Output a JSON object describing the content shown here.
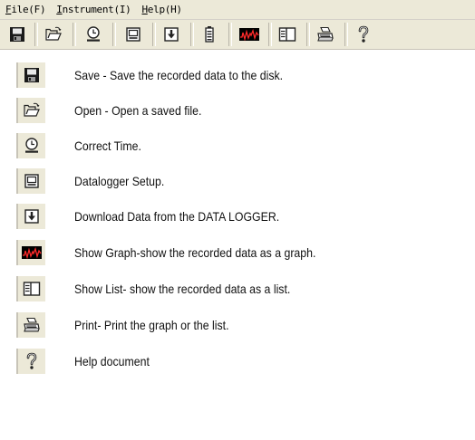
{
  "menubar": {
    "items": [
      {
        "key": "F",
        "rest": "ile(F)",
        "name": "menu-file"
      },
      {
        "key": "I",
        "rest": "nstrument(I)",
        "name": "menu-instrument"
      },
      {
        "key": "H",
        "rest": "elp(H)",
        "name": "menu-help"
      }
    ]
  },
  "toolbar": {
    "buttons": [
      {
        "icon": "save-icon"
      },
      {
        "icon": "open-folder-icon"
      },
      {
        "icon": "clock-icon"
      },
      {
        "icon": "setup-icon"
      },
      {
        "icon": "download-icon"
      },
      {
        "icon": "battery-icon"
      },
      {
        "icon": "graph-icon"
      },
      {
        "icon": "list-icon"
      },
      {
        "icon": "printer-icon"
      },
      {
        "icon": "help-icon"
      }
    ]
  },
  "legend": [
    {
      "icon": "save-icon",
      "text": "Save - Save the recorded data to the disk."
    },
    {
      "icon": "open-folder-icon",
      "text": "Open - Open a saved file."
    },
    {
      "icon": "clock-icon",
      "text": "Correct Time."
    },
    {
      "icon": "setup-icon",
      "text": "Datalogger Setup."
    },
    {
      "icon": "download-icon",
      "text": "Download Data from the DATA LOGGER."
    },
    {
      "icon": "graph-icon",
      "text": "Show Graph-show the recorded data as a graph."
    },
    {
      "icon": "list-icon",
      "text": "Show List- show the recorded data as a list."
    },
    {
      "icon": "printer-icon",
      "text": "Print- Print the graph or the list."
    },
    {
      "icon": "help-icon",
      "text": "Help document"
    }
  ]
}
